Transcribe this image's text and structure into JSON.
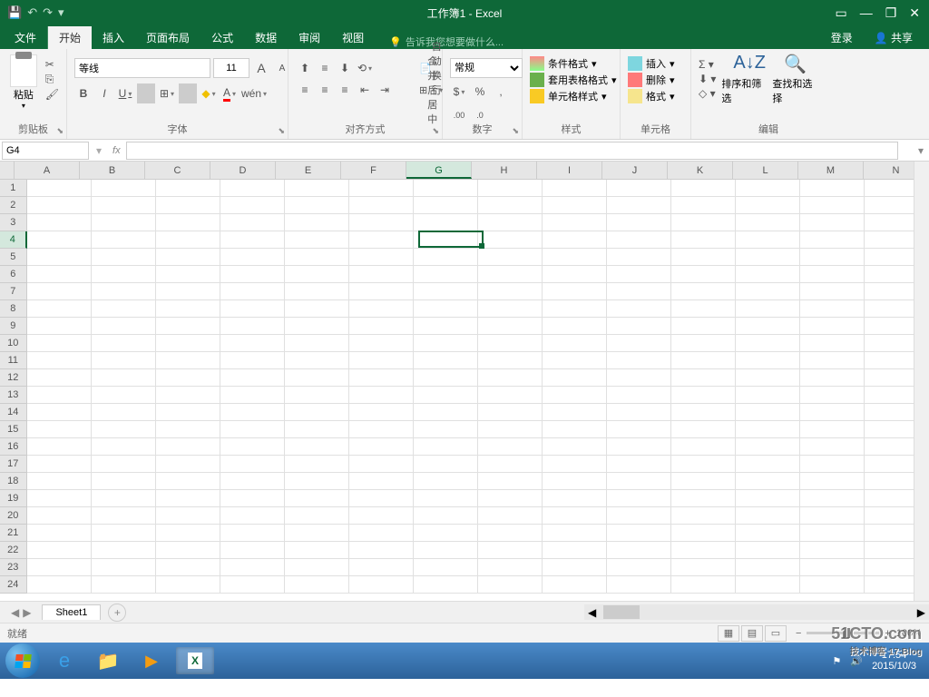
{
  "title": "工作簿1 - Excel",
  "qat": {
    "save": "💾",
    "undo": "↶",
    "redo": "↷",
    "custom": "▾"
  },
  "win": {
    "ribbon_opt": "▭",
    "min": "—",
    "max": "❐",
    "close": "✕"
  },
  "tabs": {
    "file": "文件",
    "home": "开始",
    "insert": "插入",
    "layout": "页面布局",
    "formulas": "公式",
    "data": "数据",
    "review": "审阅",
    "view": "视图"
  },
  "tellme": "告诉我您想要做什么...",
  "login": "登录",
  "share": "共享",
  "groups": {
    "clipboard": "剪贴板",
    "font": "字体",
    "align": "对齐方式",
    "number": "数字",
    "styles": "样式",
    "cells": "单元格",
    "editing": "编辑"
  },
  "clipboard": {
    "paste": "粘贴",
    "cut": "✂",
    "copy": "⎘",
    "painter": "🖌"
  },
  "font": {
    "name": "等线",
    "size": "11",
    "grow": "A",
    "shrink": "A",
    "bold": "B",
    "italic": "I",
    "underline": "U",
    "border": "⊞",
    "fill": "◆",
    "color": "A",
    "phonetic": "wén"
  },
  "align": {
    "wrap": "自动换行",
    "merge": "合并后居中"
  },
  "number": {
    "format": "常规",
    "currency": "$",
    "percent": "%",
    "comma": ",",
    "inc": ".00→.0",
    "dec": ".0→.00"
  },
  "styles": {
    "cond": "条件格式",
    "table": "套用表格格式",
    "cell": "单元格样式"
  },
  "cells": {
    "insert": "插入",
    "delete": "删除",
    "format": "格式"
  },
  "editing": {
    "sum": "Σ",
    "fill": "⬇",
    "clear": "◇",
    "sort": "排序和筛选",
    "find": "查找和选择"
  },
  "namebox": "G4",
  "formula_fx": "fx",
  "columns": [
    "A",
    "B",
    "C",
    "D",
    "E",
    "F",
    "G",
    "H",
    "I",
    "J",
    "K",
    "L",
    "M",
    "N"
  ],
  "rows": 24,
  "active": {
    "col": "G",
    "colIndex": 6,
    "row": 4
  },
  "sheet": "Sheet1",
  "status": "就绪",
  "zoom": "100%",
  "tray": {
    "time": "17:54",
    "date": "2015/10/3"
  },
  "watermark": {
    "main": "51CTO.com",
    "sub": "技术博客 17:Blog"
  }
}
